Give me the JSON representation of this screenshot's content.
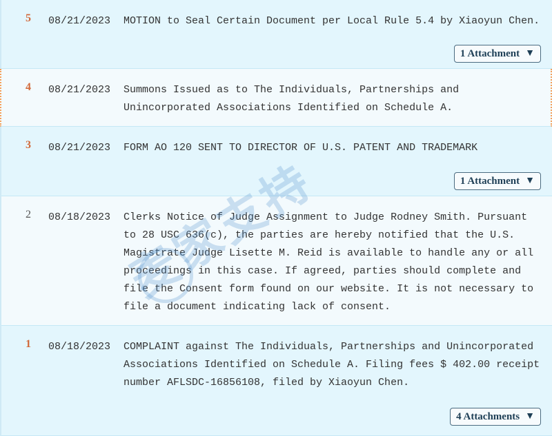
{
  "entries": [
    {
      "num": "5",
      "date": "08/21/2023",
      "desc": "MOTION to Seal Certain Document per Local Rule 5.4 by Xiaoyun Chen.",
      "attachment": "1 Attachment"
    },
    {
      "num": "4",
      "date": "08/21/2023",
      "desc": "Summons Issued as to The Individuals, Partnerships and Unincorporated Associations Identified on Schedule A."
    },
    {
      "num": "3",
      "date": "08/21/2023",
      "desc": "FORM AO 120 SENT TO DIRECTOR OF U.S. PATENT AND TRADEMARK",
      "attachment": "1 Attachment"
    },
    {
      "num": "2",
      "date": "08/18/2023",
      "desc": "Clerks Notice of Judge Assignment to Judge Rodney Smith. Pursuant to 28 USC 636(c), the parties are hereby notified that the U.S. Magistrate Judge Lisette M. Reid is available to handle any or all proceedings in this case. If agreed, parties should complete and file the Consent form found on our website. It is not necessary to file a document indicating lack of consent."
    },
    {
      "num": "1",
      "date": "08/18/2023",
      "desc": "COMPLAINT against The Individuals, Partnerships and Unincorporated Associations Identified on Schedule A. Filing fees $ 402.00 receipt number AFLSDC-16856108, filed by Xiaoyun Chen.",
      "attachment": "4 Attachments"
    }
  ],
  "dropdown_icon": "▼",
  "watermark": "麦家支持",
  "colors": {
    "bg": "#e3f6fd",
    "number": "#d2693a",
    "button_border": "#4a6b80"
  }
}
